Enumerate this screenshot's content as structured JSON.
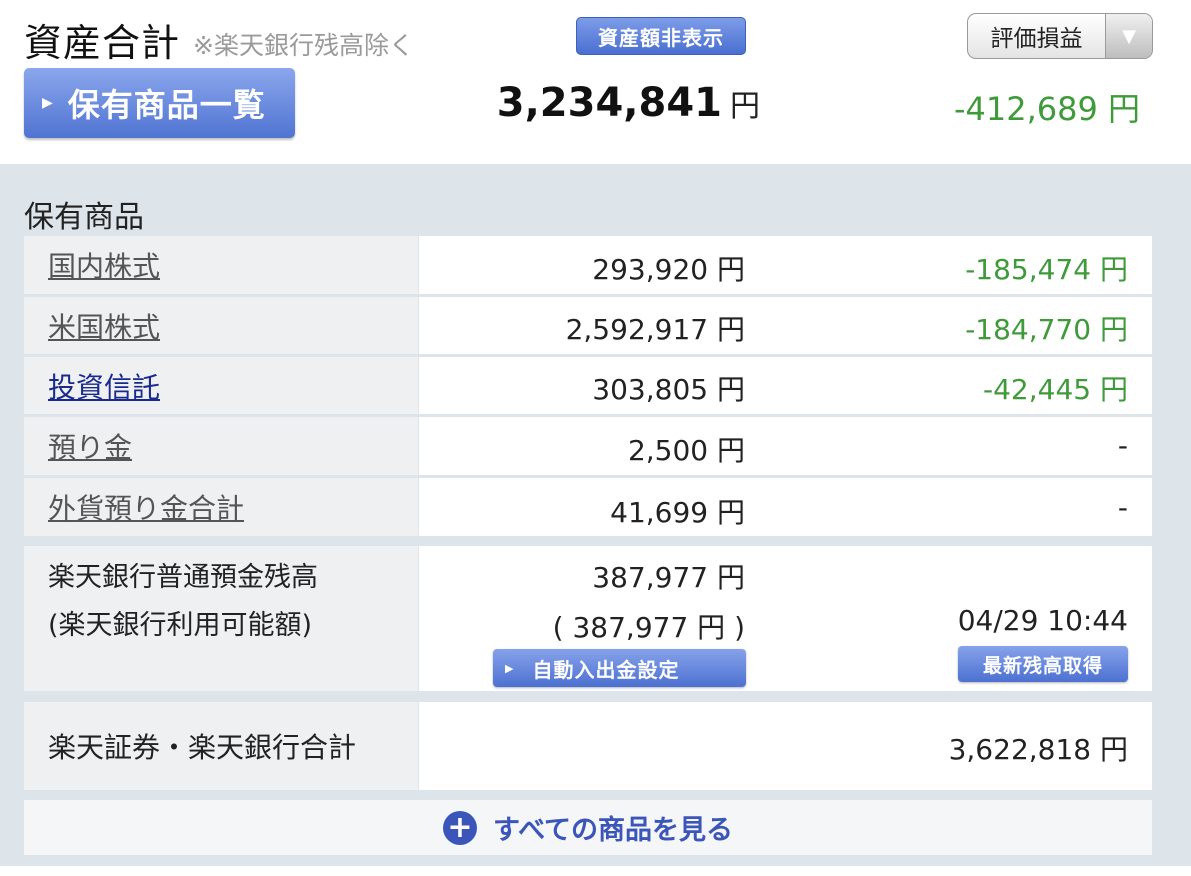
{
  "header": {
    "title": "資産合計",
    "title_note": "※楽天銀行残高除く",
    "hide_button": "資産額非表示",
    "select_value": "評価損益",
    "holdings_button": "保有商品一覧",
    "total_amount": "3,234,841",
    "currency_unit": "円",
    "total_gain": "-412,689 円"
  },
  "section": {
    "title": "保有商品"
  },
  "rows": [
    {
      "label": "国内株式",
      "amount": "293,920 円",
      "gain": "-185,474 円"
    },
    {
      "label": "米国株式",
      "amount": "2,592,917 円",
      "gain": "-184,770 円"
    },
    {
      "label": "投資信託",
      "amount": "303,805 円",
      "gain": "-42,445 円"
    },
    {
      "label": "預り金",
      "amount": "2,500 円",
      "gain": "-"
    },
    {
      "label": "外貨預り金合計",
      "amount": "41,699 円",
      "gain": "-"
    }
  ],
  "bank": {
    "label_line1": "楽天銀行普通預金残高",
    "label_line2": "(楽天銀行利用可能額)",
    "amount": "387,977 円",
    "available": "( 387,977 円 )",
    "auto_button": "自動入出金設定",
    "updated": "04/29 10:44",
    "refresh_button": "最新残高取得"
  },
  "grand_total": {
    "label": "楽天証券・楽天銀行合計",
    "amount": "3,622,818 円"
  },
  "see_all": "すべての商品を見る",
  "colors": {
    "gain_negative": "#3f9a3a",
    "button_blue": "#5074d2",
    "panel_bg": "#dde4ea"
  }
}
